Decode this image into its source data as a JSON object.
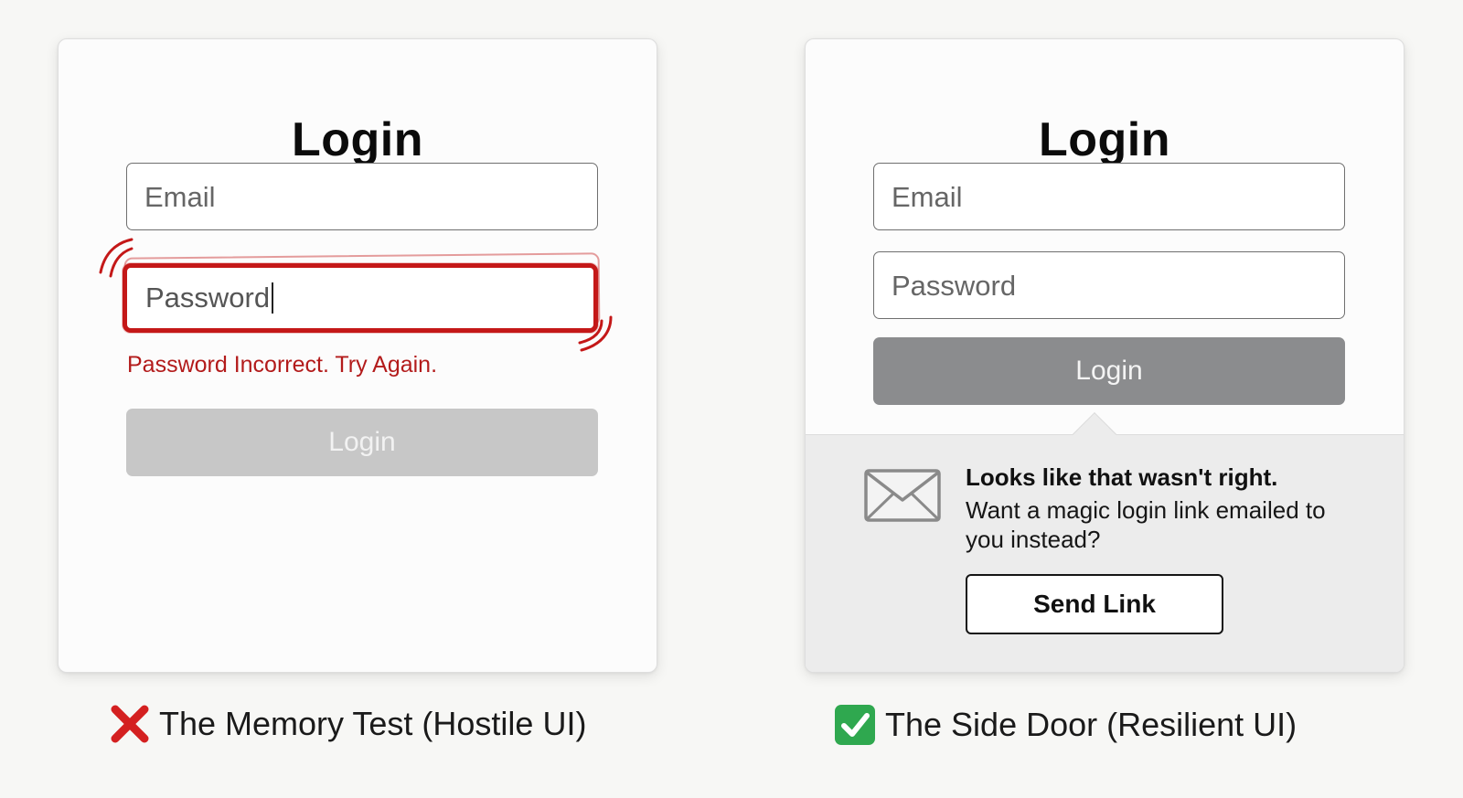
{
  "hostile": {
    "title": "Login",
    "email_placeholder": "Email",
    "password_value": "Password",
    "error_message": "Password Incorrect. Try Again.",
    "login_label": "Login",
    "login_state": "disabled",
    "error_color": "#c41818",
    "caption": "The Memory Test (Hostile UI)",
    "caption_icon": "red-x-icon"
  },
  "resilient": {
    "title": "Login",
    "email_placeholder": "Email",
    "password_placeholder": "Password",
    "login_label": "Login",
    "help": {
      "icon": "envelope-icon",
      "title": "Looks like that wasn't right.",
      "body": "Want a magic login link emailed to you instead?",
      "button_label": "Send Link"
    },
    "caption": "The Side Door (Resilient UI)",
    "caption_icon": "green-check-icon"
  },
  "colors": {
    "error_red": "#c41818",
    "button_gray": "#8b8c8e",
    "disabled_gray": "#c7c7c7",
    "check_green": "#2fa84f"
  }
}
